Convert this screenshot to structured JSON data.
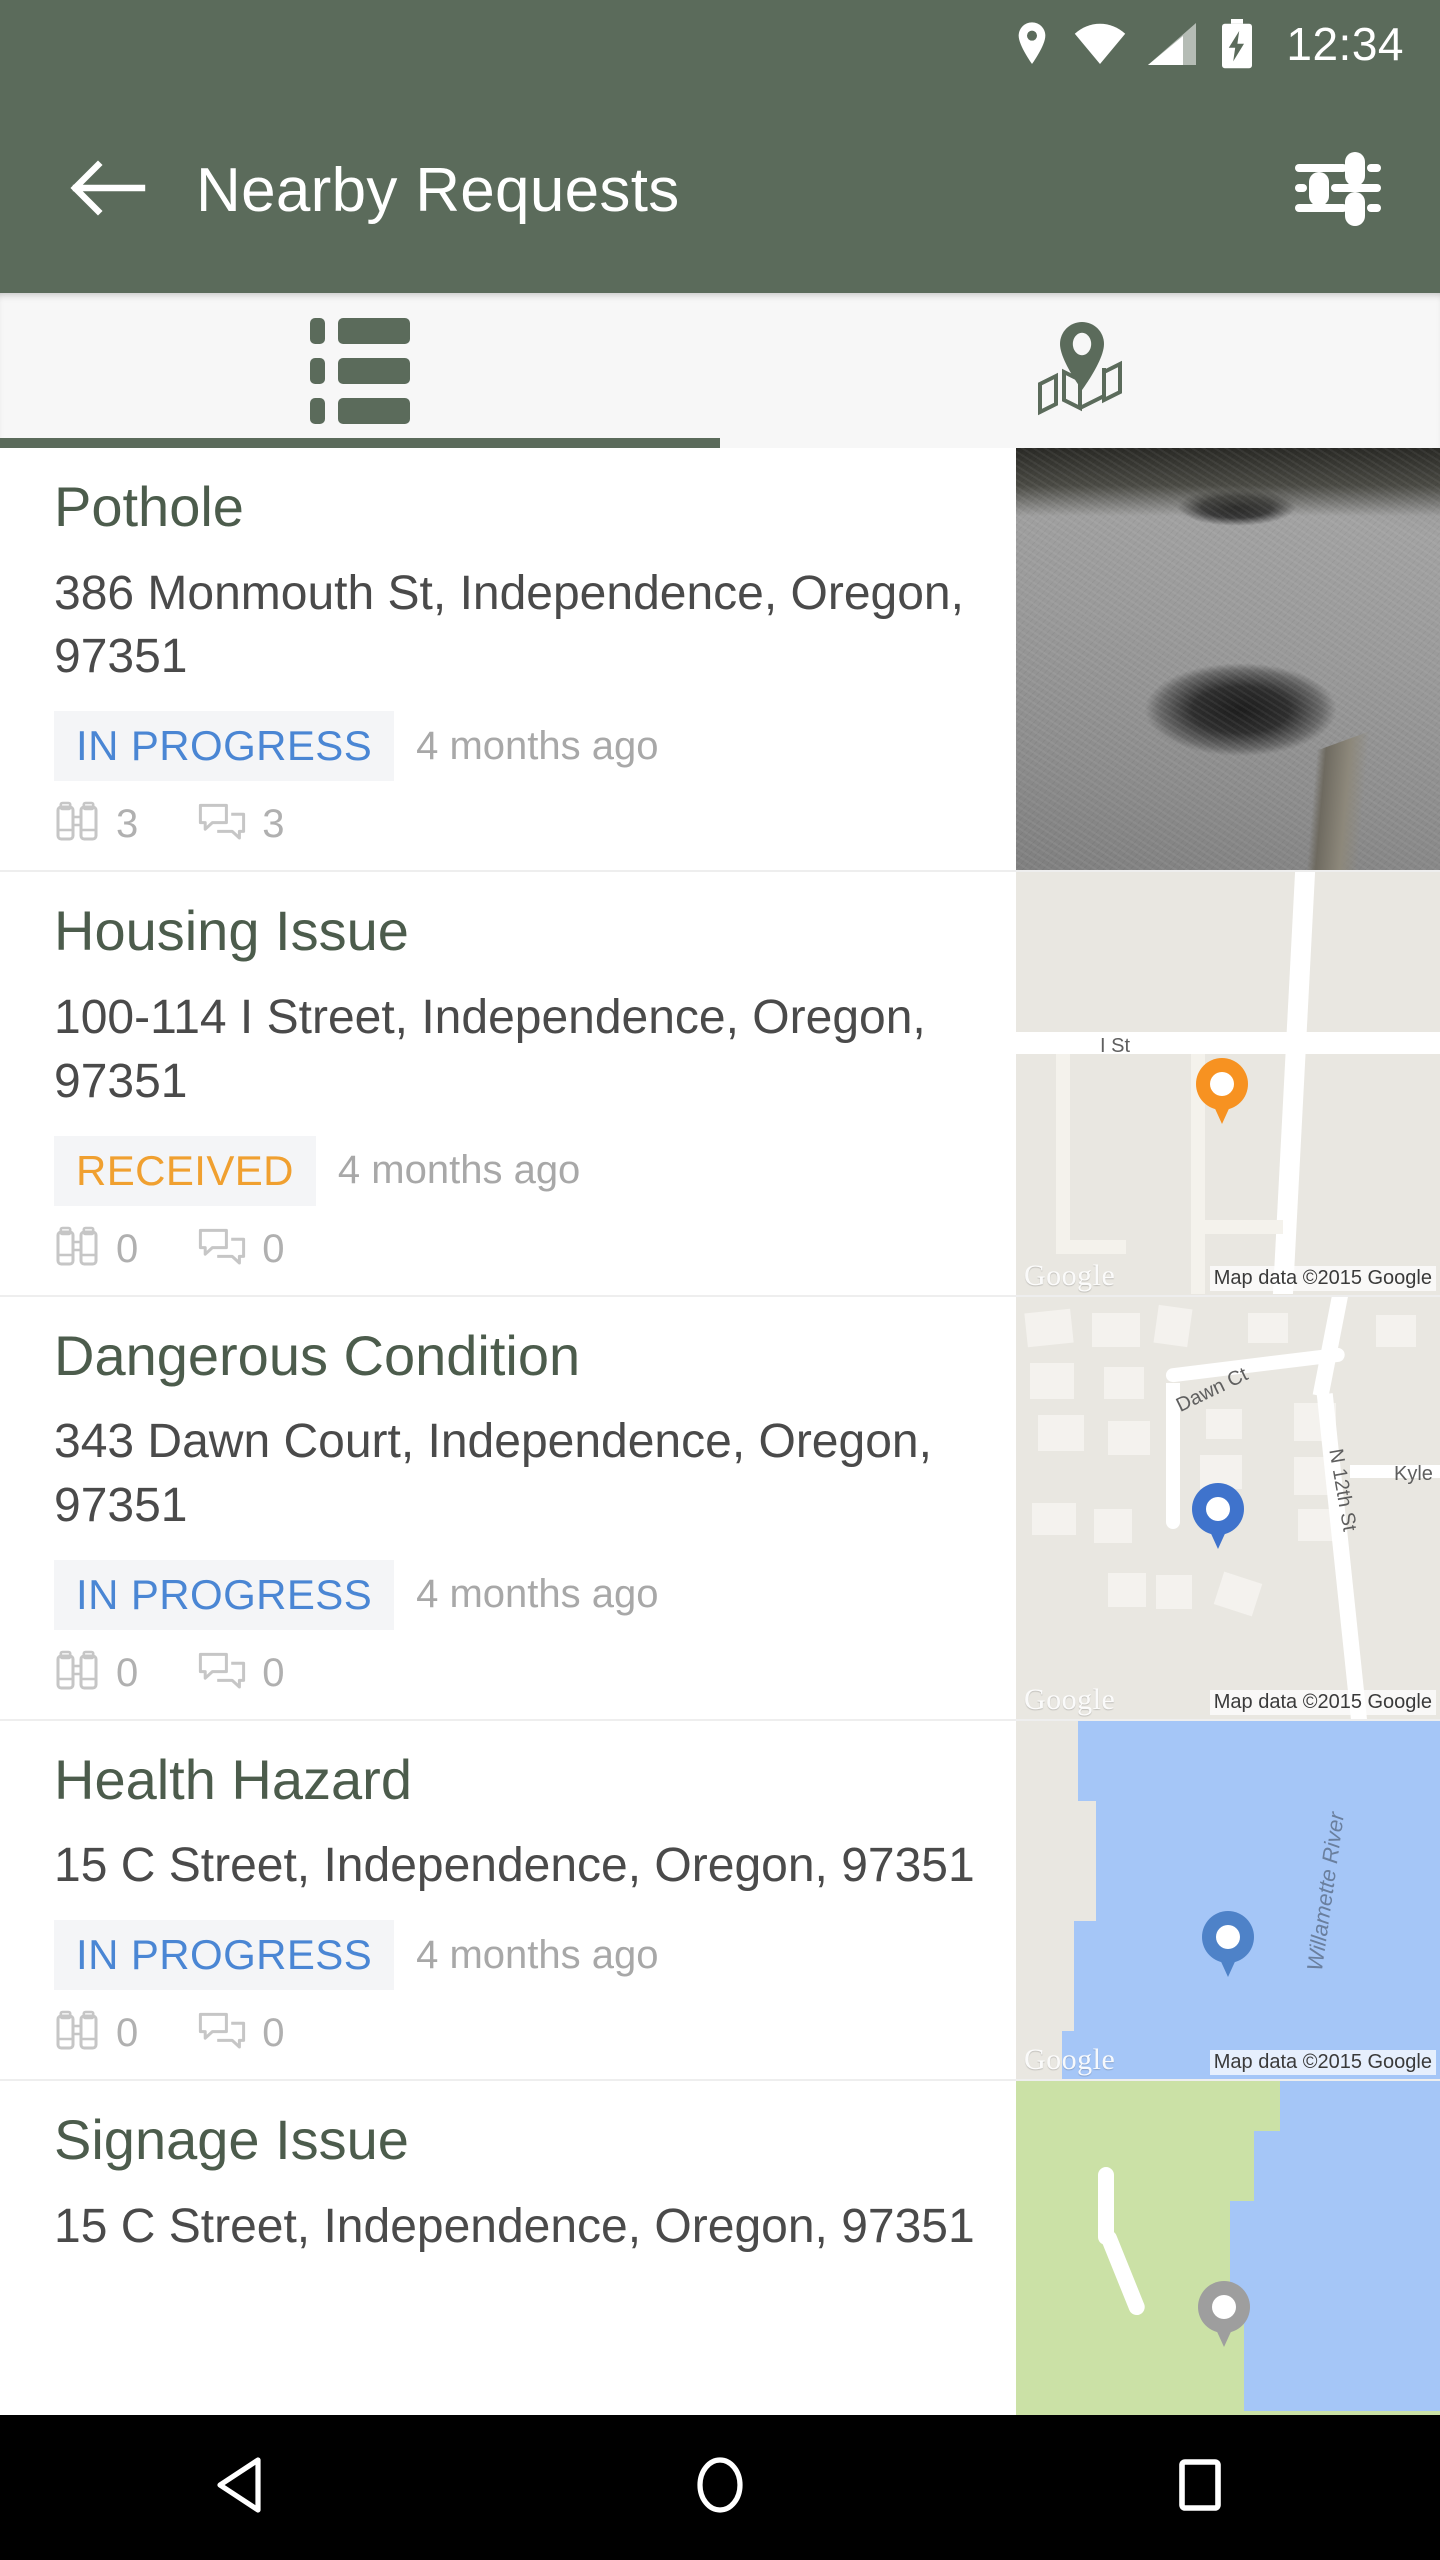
{
  "status_bar": {
    "time": "12:34",
    "icons": [
      "location-pin-icon",
      "wifi-icon",
      "cellular-signal-icon",
      "battery-charging-icon"
    ]
  },
  "app_bar": {
    "title": "Nearby Requests",
    "back_icon": "arrow-left-icon",
    "filter_icon": "tune-filter-icon"
  },
  "tabs": [
    {
      "id": "list",
      "icon": "list-view-icon",
      "active": true
    },
    {
      "id": "map",
      "icon": "map-pin-view-icon",
      "active": false
    }
  ],
  "colors": {
    "app_bar": "#5b6b5b",
    "status_in_progress": "#4a86d4",
    "status_received": "#f0a030",
    "badge_background": "#f4f5f7",
    "title_text": "#4c5c4c",
    "body_text": "#4a4a4a",
    "muted_text": "#a8a8a8"
  },
  "requests": [
    {
      "title": "Pothole",
      "address": "386  Monmouth St, Independence, Oregon, 97351",
      "status": "IN PROGRESS",
      "status_type": "inprogress",
      "time_ago": "4 months ago",
      "watchers": "3",
      "comments": "3",
      "thumbnail": {
        "type": "photo",
        "subject": "pothole-in-asphalt-road"
      }
    },
    {
      "title": "Housing Issue",
      "address": "100-114  I Street, Independence, Oregon, 97351",
      "status": "RECEIVED",
      "status_type": "received",
      "time_ago": "4 months ago",
      "watchers": "0",
      "comments": "0",
      "thumbnail": {
        "type": "map",
        "pin_color": "orange",
        "street_labels": [
          "I St"
        ],
        "watermark": "Google",
        "attribution": "Map data ©2015 Google"
      }
    },
    {
      "title": "Dangerous Condition",
      "address": "343  Dawn Court, Independence, Oregon, 97351",
      "status": "IN PROGRESS",
      "status_type": "inprogress",
      "time_ago": "4 months ago",
      "watchers": "0",
      "comments": "0",
      "thumbnail": {
        "type": "map",
        "pin_color": "blue",
        "street_labels": [
          "Dawn Ct",
          "N 12th St",
          "Kyle"
        ],
        "watermark": "Google",
        "attribution": "Map data ©2015 Google"
      }
    },
    {
      "title": "Health Hazard",
      "address": "15  C Street, Independence, Oregon, 97351",
      "status": "IN PROGRESS",
      "status_type": "inprogress",
      "time_ago": "4 months ago",
      "watchers": "0",
      "comments": "0",
      "thumbnail": {
        "type": "map",
        "pin_color": "blue",
        "street_labels": [
          "Willamette River"
        ],
        "watermark": "Google",
        "attribution": "Map data ©2015 Google"
      }
    },
    {
      "title": "Signage Issue",
      "address": "15  C Street, Independence, Oregon, 97351",
      "thumbnail": {
        "type": "map",
        "pin_color": "gray",
        "street_labels": []
      }
    }
  ],
  "nav_bar": {
    "buttons": [
      {
        "id": "back",
        "icon": "triangle-back-icon"
      },
      {
        "id": "home",
        "icon": "circle-home-icon"
      },
      {
        "id": "recents",
        "icon": "square-recents-icon"
      }
    ]
  }
}
